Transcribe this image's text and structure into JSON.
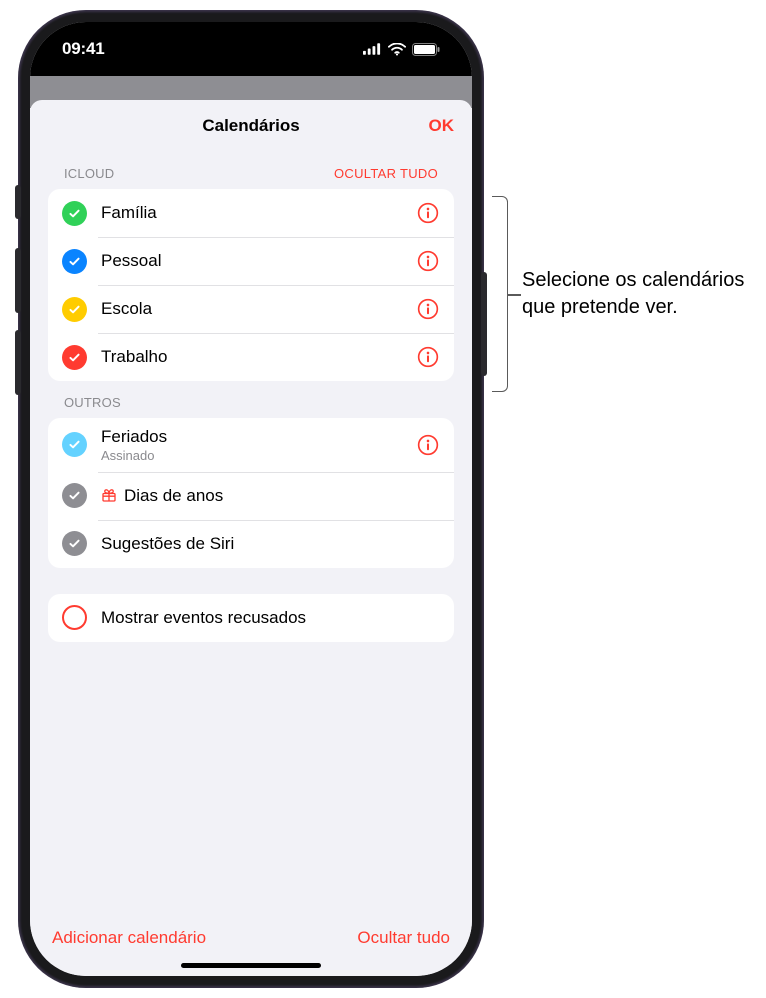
{
  "status": {
    "time": "09:41"
  },
  "sheet": {
    "title": "Calendários",
    "ok": "OK"
  },
  "sections": {
    "icloud": {
      "label": "ICLOUD",
      "action": "OCULTAR TUDO",
      "items": [
        {
          "title": "Família"
        },
        {
          "title": "Pessoal"
        },
        {
          "title": "Escola"
        },
        {
          "title": "Trabalho"
        }
      ]
    },
    "outros": {
      "label": "OUTROS",
      "items": [
        {
          "title": "Feriados",
          "sub": "Assinado"
        },
        {
          "title": "Dias de anos"
        },
        {
          "title": "Sugestões de Siri"
        }
      ]
    },
    "toggle": {
      "title": "Mostrar eventos recusados"
    }
  },
  "footer": {
    "add": "Adicionar calendário",
    "hide": "Ocultar tudo"
  },
  "callout": "Selecione os calendários que pretende ver."
}
